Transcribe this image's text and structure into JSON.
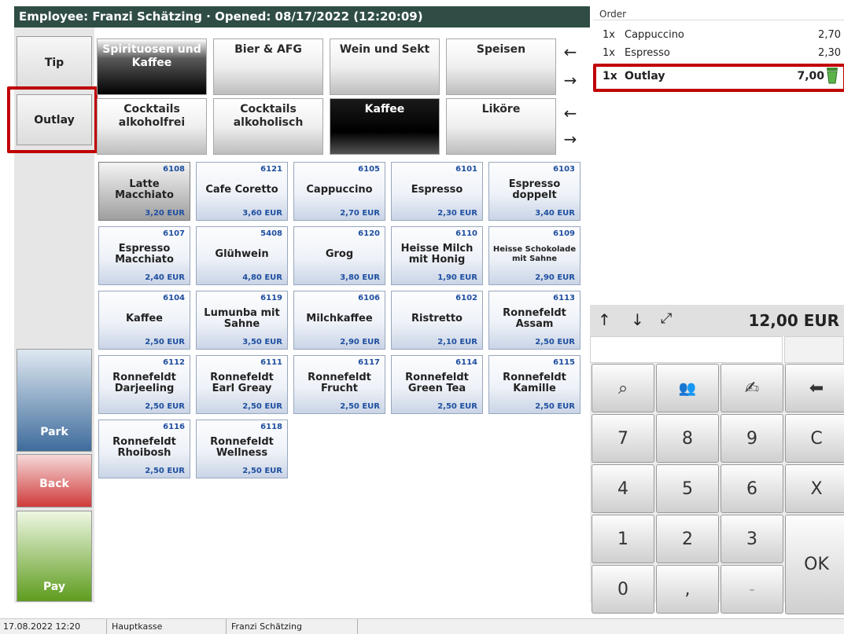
{
  "header": {
    "title": "Employee: Franzi Schätzing · Opened: 08/17/2022 (12:20:09)"
  },
  "left_buttons": {
    "tip": "Tip",
    "outlay": "Outlay",
    "park": "Park",
    "back": "Back",
    "pay": "Pay"
  },
  "categories_row1": [
    "Spirituosen und Kaffee",
    "Bier & AFG",
    "Wein und Sekt",
    "Speisen"
  ],
  "categories_row2": [
    "Cocktails alkoholfrei",
    "Cocktails alkoholisch",
    "Kaffee",
    "Liköre"
  ],
  "arrows": {
    "left": "←",
    "right": "→"
  },
  "products": [
    {
      "code": "6108",
      "name": "Latte Macchiato",
      "price": "3,20 EUR"
    },
    {
      "code": "6121",
      "name": "Cafe Coretto",
      "price": "3,60 EUR"
    },
    {
      "code": "6105",
      "name": "Cappuccino",
      "price": "2,70 EUR"
    },
    {
      "code": "6101",
      "name": "Espresso",
      "price": "2,30 EUR"
    },
    {
      "code": "6103",
      "name": "Espresso doppelt",
      "price": "3,40 EUR"
    },
    {
      "code": "6107",
      "name": "Espresso Macchiato",
      "price": "2,40 EUR"
    },
    {
      "code": "5408",
      "name": "Glühwein",
      "price": "4,80 EUR"
    },
    {
      "code": "6120",
      "name": "Grog",
      "price": "3,80 EUR"
    },
    {
      "code": "6110",
      "name": "Heisse Milch mit Honig",
      "price": "1,90 EUR"
    },
    {
      "code": "6109",
      "name": "Heisse Schokolade mit Sahne",
      "price": "2,90 EUR"
    },
    {
      "code": "6104",
      "name": "Kaffee",
      "price": "2,50 EUR"
    },
    {
      "code": "6119",
      "name": "Lumunba mit Sahne",
      "price": "3,50 EUR"
    },
    {
      "code": "6106",
      "name": "Milchkaffee",
      "price": "2,90 EUR"
    },
    {
      "code": "6102",
      "name": "Ristretto",
      "price": "2,10 EUR"
    },
    {
      "code": "6113",
      "name": "Ronnefeldt Assam",
      "price": "2,50 EUR"
    },
    {
      "code": "6112",
      "name": "Ronnefeldt Darjeeling",
      "price": "2,50 EUR"
    },
    {
      "code": "6111",
      "name": "Ronnefeldt Earl Greay",
      "price": "2,50 EUR"
    },
    {
      "code": "6117",
      "name": "Ronnefeldt Frucht",
      "price": "2,50 EUR"
    },
    {
      "code": "6114",
      "name": "Ronnefeldt Green Tea",
      "price": "2,50 EUR"
    },
    {
      "code": "6115",
      "name": "Ronnefeldt Kamille",
      "price": "2,50 EUR"
    },
    {
      "code": "6116",
      "name": "Ronnefeldt Rhoibosh",
      "price": "2,50 EUR"
    },
    {
      "code": "6118",
      "name": "Ronnefeldt Wellness",
      "price": "2,50 EUR"
    }
  ],
  "order": {
    "header": "Order",
    "items": [
      {
        "qty": "1x",
        "name": "Cappuccino",
        "price": "2,70"
      },
      {
        "qty": "1x",
        "name": "Espresso",
        "price": "2,30"
      },
      {
        "qty": "1x",
        "name": "Outlay",
        "price": "7,00"
      }
    ],
    "total": "12,00 EUR"
  },
  "total_nav": {
    "up": "↑",
    "down": "↓",
    "expand": "⤢"
  },
  "keypad": {
    "search": "⌕",
    "customer": "👥",
    "sign": "✍",
    "back": "⬅",
    "k7": "7",
    "k8": "8",
    "k9": "9",
    "clear": "C",
    "k4": "4",
    "k5": "5",
    "k6": "6",
    "x": "X",
    "k1": "1",
    "k2": "2",
    "k3": "3",
    "ok": "OK",
    "k0": "0",
    "comma": ",",
    "minus": "-"
  },
  "status": {
    "datetime": "17.08.2022 12:20",
    "register": "Hauptkasse",
    "employee": "Franzi Schätzing"
  }
}
